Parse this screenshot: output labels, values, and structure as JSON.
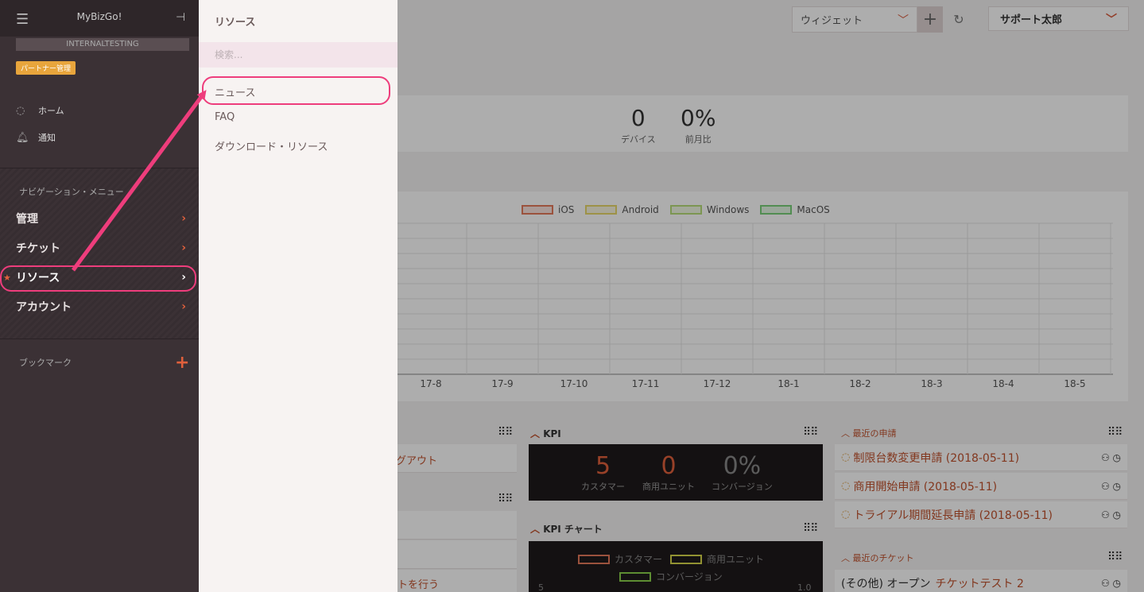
{
  "topbar": {
    "widget_label": "ウィジェット",
    "user_label": "サポート太郎"
  },
  "stats": [
    {
      "value": "0",
      "label": "デバイス"
    },
    {
      "value": "0%",
      "label": "前月比"
    }
  ],
  "chart_data": {
    "type": "line",
    "x": [
      "17-8",
      "17-9",
      "17-10",
      "17-11",
      "17-12",
      "18-1",
      "18-2",
      "18-3",
      "18-4",
      "18-5"
    ],
    "series": [
      {
        "name": "iOS",
        "color": "#e57a5a",
        "values": []
      },
      {
        "name": "Android",
        "color": "#e8d86a",
        "values": []
      },
      {
        "name": "Windows",
        "color": "#b7dd7a",
        "values": []
      },
      {
        "name": "MacOS",
        "color": "#7ad07a",
        "values": []
      }
    ],
    "grid": true,
    "legend": "top-center"
  },
  "left_panel": {
    "card1_text": "グアウト",
    "card3_text": "トを行う"
  },
  "kpi": {
    "title": "KPI",
    "stats": [
      {
        "value": "5",
        "label": "カスタマー",
        "color": "#e0603c"
      },
      {
        "value": "0",
        "label": "商用ユニット",
        "color": "#e0603c"
      },
      {
        "value": "0%",
        "label": "コンバージョン",
        "color": "#888888"
      }
    ]
  },
  "kpi_chart": {
    "title": "KPI チャート",
    "legend": [
      {
        "name": "カスタマー",
        "color": "#e57a5a"
      },
      {
        "name": "商用ユニット",
        "color": "#d8d84a"
      },
      {
        "name": "コンバージョン",
        "color": "#8ad04a"
      }
    ],
    "y_left": "5",
    "y_right": "1.0"
  },
  "recent_requests": {
    "title": "最近の申請",
    "items": [
      "制限台数変更申請 (2018-05-11)",
      "商用開始申請 (2018-05-11)",
      "トライアル期間延長申請 (2018-05-11)"
    ]
  },
  "recent_tickets": {
    "title": "最近のチケット",
    "item_prefix": "(その他) オープン",
    "item_link": "チケットテスト 2"
  },
  "sidebar": {
    "app_title": "MyBizGo!",
    "env_label": "INTERNALTESTING",
    "partner_badge": "パートナー管理",
    "links": [
      {
        "label": "ホーム",
        "icon": "circle-icon"
      },
      {
        "label": "通知",
        "icon": "bell-icon"
      }
    ],
    "nav_section": "ナビゲーション・メニュー",
    "nav_items": [
      "管理",
      "チケット",
      "リソース",
      "アカウント"
    ],
    "bookmark_label": "ブックマーク"
  },
  "flyout": {
    "title": "リソース",
    "search_placeholder": "検索...",
    "items": [
      "ニュース",
      "FAQ",
      "ダウンロード・リソース"
    ]
  },
  "annotation": {
    "color": "#ee3d7c"
  }
}
